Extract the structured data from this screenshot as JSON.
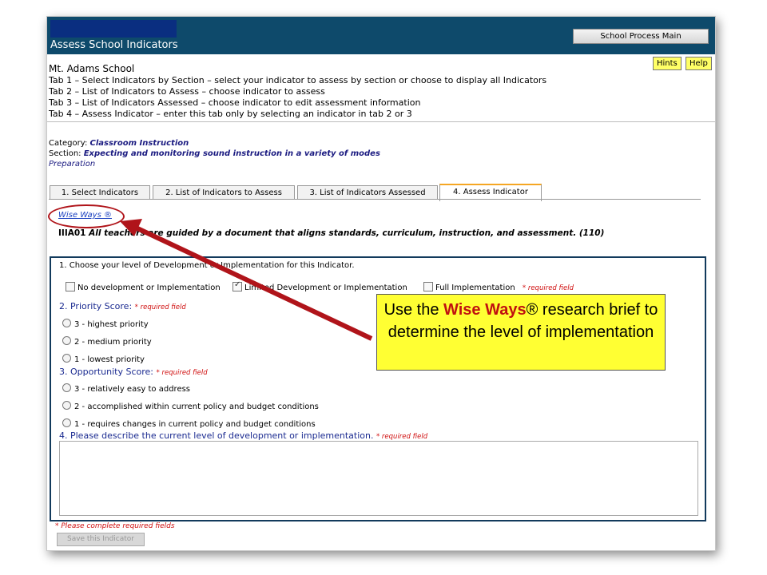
{
  "header": {
    "title": "Assess School Indicators",
    "main_button": "School Process Main"
  },
  "school_name": "Mt. Adams School",
  "hints_label": "Hints",
  "help_label": "Help",
  "tab_descriptions": [
    "Tab 1 – Select Indicators by Section – select your indicator to assess by section or choose to display all Indicators",
    "Tab 2 – List of Indicators to Assess – choose indicator to assess",
    "Tab 3 – List of Indicators Assessed – choose indicator to edit assessment information",
    "Tab 4 – Assess Indicator – enter this tab only by selecting an indicator in tab 2 or 3"
  ],
  "category_label": "Category:",
  "category_value": "Classroom Instruction",
  "section_label": "Section:",
  "section_value": "Expecting and monitoring sound instruction in a variety of modes",
  "subsection": "Preparation",
  "tabs": [
    "1.  Select Indicators",
    "2. List of Indicators to Assess",
    "3. List of Indicators Assessed",
    "4. Assess Indicator"
  ],
  "wise_ways_link": "Wise Ways ®",
  "indicator_code": "IIIA01",
  "indicator_text": "All teachers are guided by a document that aligns standards, curriculum, instruction, and assessment. (110)",
  "q1": {
    "text": "1. Choose your level of Development or Implementation for this Indicator.",
    "options": [
      "No development or Implementation",
      "Limited Development or Implementation",
      "Full Implementation"
    ],
    "checked_index": 1
  },
  "required_field": "* required field",
  "q2": {
    "text": "2. Priority Score:",
    "options": [
      "3 - highest priority",
      "2 - medium priority",
      "1 - lowest priority"
    ]
  },
  "q3": {
    "text": "3. Opportunity Score:",
    "options": [
      "3 - relatively easy to address",
      "2 - accomplished within current policy and budget conditions",
      "1 - requires changes in current policy and budget conditions"
    ]
  },
  "q4": {
    "text": "4. Please describe the current level of development or implementation."
  },
  "required_note": "* Please complete required fields",
  "save_button": "Save this Indicator",
  "callout": {
    "before": "Use the ",
    "highlight": "Wise Ways",
    "after": "® research brief to determine the level of implementation"
  },
  "colors": {
    "header_bg": "#0e4a6b",
    "callout_bg": "#ffff33",
    "arrow": "#b0141a",
    "required": "#d01010"
  }
}
